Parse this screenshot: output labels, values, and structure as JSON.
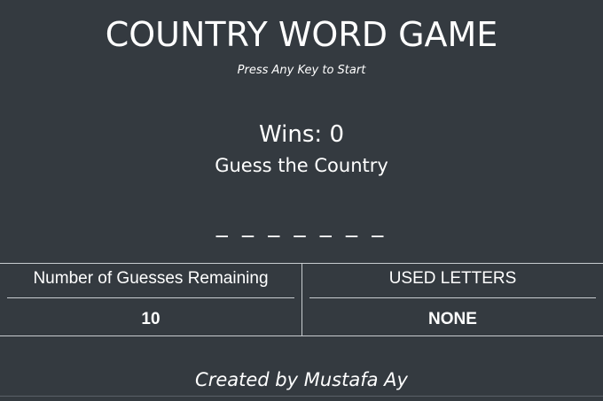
{
  "game": {
    "title": "COUNTRY WORD GAME",
    "subtitle": "Press Any Key to Start",
    "wins_label": "Wins:",
    "wins_value": "0",
    "prompt": "Guess the Country",
    "masked_word": "_ _ _ _ _ _ _"
  },
  "stats": {
    "guesses_header": "Number of Guesses Remaining",
    "guesses_value": "10",
    "used_header": "USED LETTERS",
    "used_value": "NONE"
  },
  "footer": {
    "credit": "Created by Mustafa Ay"
  },
  "colors": {
    "background": "#343a40",
    "text": "#ffffff",
    "rule": "#c8ccd0"
  }
}
